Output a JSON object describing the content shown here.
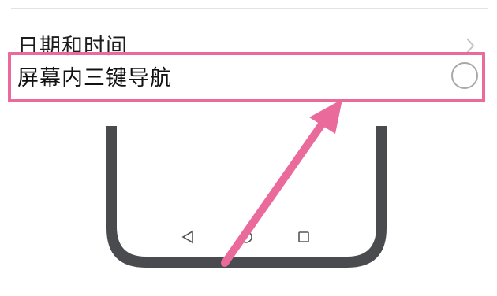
{
  "settings": {
    "date_time_label": "日期和时间",
    "nav_label": "屏幕内三键导航"
  },
  "icons": {
    "chevron": "chevron-right-icon",
    "radio": "radio-unchecked-icon",
    "back": "back-triangle-icon",
    "home": "home-circle-icon",
    "recent": "recent-square-icon"
  },
  "colors": {
    "highlight": "#e96a9b",
    "phone_frame": "#4a4b4f",
    "arrow": "#e96a9b"
  }
}
